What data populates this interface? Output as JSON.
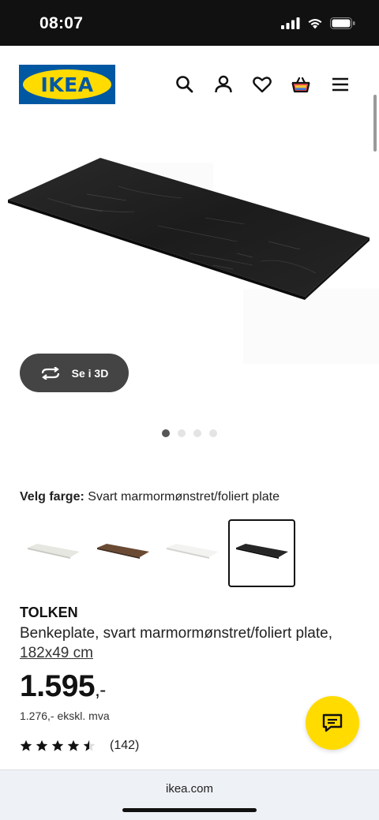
{
  "status_bar": {
    "time": "08:07"
  },
  "header": {
    "logo_text": "IKEA",
    "icons": [
      "search-icon",
      "account-icon",
      "heart-icon",
      "basket-icon",
      "menu-icon"
    ]
  },
  "hero": {
    "view_3d_label": "Se i 3D",
    "carousel_dots": 4,
    "active_dot": 0
  },
  "color_select": {
    "label": "Velg farge:",
    "value": "Svart marmormønstret/foliert plate",
    "swatches": [
      "grey-white",
      "brown-wood",
      "white",
      "black-marble"
    ],
    "selected_index": 3
  },
  "product": {
    "name": "TOLKEN",
    "description": "Benkeplate, svart marmormønstret/foliert plate,",
    "size_link": "182x49 cm",
    "price": "1.595",
    "price_suffix": ",-",
    "price_ex_vat": "1.276,- ekskl. mva",
    "rating_value": 4.5,
    "review_count": "(142)"
  },
  "browser": {
    "url": "ikea.com"
  },
  "colors": {
    "brand_blue": "#0058a3",
    "brand_yellow": "#ffdb00"
  }
}
